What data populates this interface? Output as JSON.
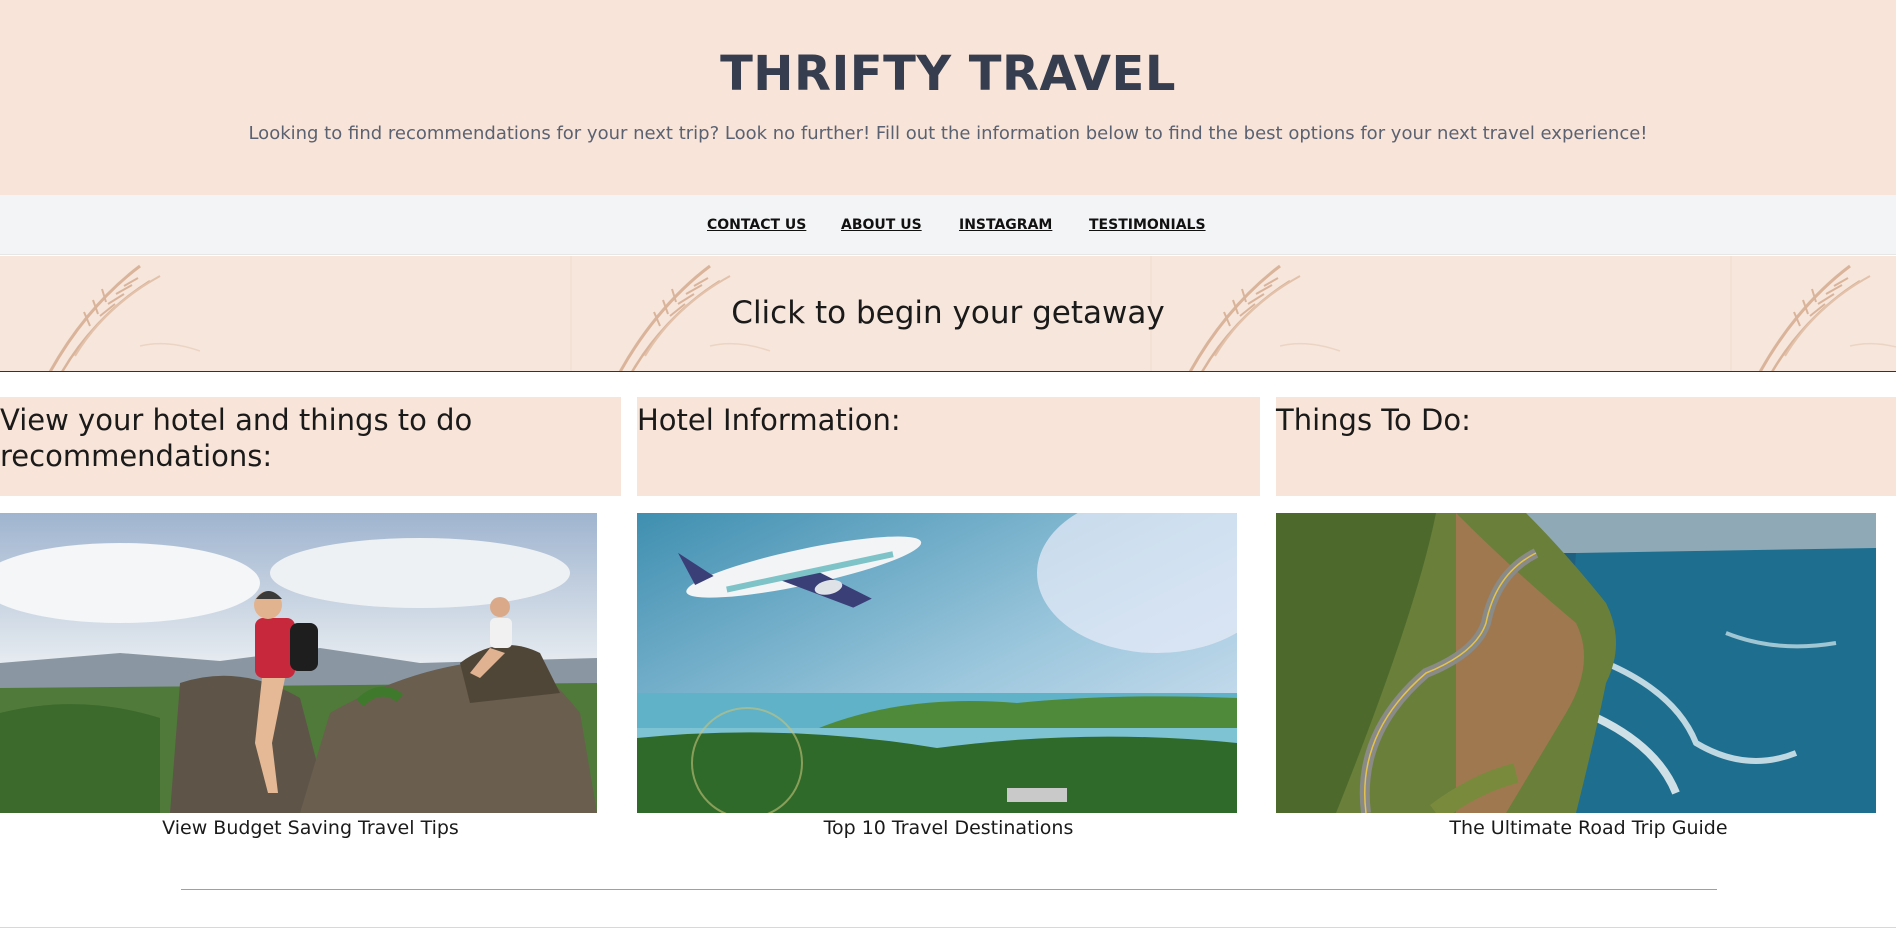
{
  "header": {
    "title": "THRIFTY TRAVEL",
    "tagline": "Looking to find recommendations for your next trip? Look no further! Fill out the information below to find the best options for your next travel experience!"
  },
  "nav": {
    "items": [
      {
        "label": "CONTACT US"
      },
      {
        "label": "ABOUT US"
      },
      {
        "label": "INSTAGRAM"
      },
      {
        "label": "TESTIMONIALS"
      }
    ]
  },
  "banner": {
    "cta": "Click to begin your getaway",
    "decoration": "dried-grass-pattern"
  },
  "columns": [
    {
      "heading": "View your hotel and things to do recommendations:",
      "image": "hikers-on-rocks-photo",
      "caption": "View Budget Saving Travel Tips"
    },
    {
      "heading": "Hotel Information:",
      "image": "airplane-over-island-photo",
      "caption": "Top 10 Travel Destinations"
    },
    {
      "heading": "Things To Do:",
      "image": "coastal-road-photo",
      "caption": "The Ultimate Road Trip Guide"
    }
  ],
  "colors": {
    "accent_peach": "#f8e4d8",
    "title_slate": "#363d4f",
    "nav_bg": "#f3f4f6"
  }
}
